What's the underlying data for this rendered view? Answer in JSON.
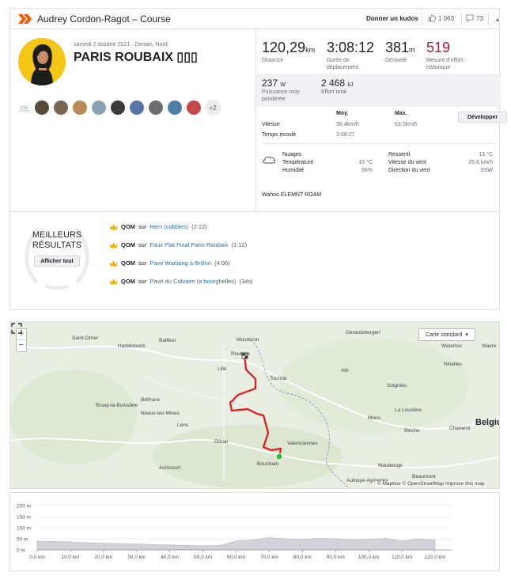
{
  "header": {
    "title": "Audrey Cordon-Ragot – Course",
    "kudos_label": "Donner un kudos",
    "kudos_count": "1 063",
    "comments_count": "73"
  },
  "activity": {
    "date_location": "samedi 2 octobre 2021 · Denain, Nord",
    "name": "PARIS ROUBAIX ▯▯▯",
    "extra_athletes": "+2"
  },
  "stats": {
    "distance": {
      "value": "120,29",
      "unit": "km",
      "label": "Distance"
    },
    "moving_time": {
      "value": "3:08:12",
      "label": "Durée de déplacement"
    },
    "elevation": {
      "value": "381",
      "unit": "m",
      "label": "Dénivelé"
    },
    "suffer": {
      "value": "519",
      "label": "Mesure d'effort : historique"
    },
    "power": {
      "value": "237",
      "unit": "W",
      "label": "Puissance moy. pondérée"
    },
    "work": {
      "value": "2 468",
      "unit": "kJ",
      "label": "Effort total"
    }
  },
  "metrics": {
    "col_avg": "Moy.",
    "col_max": "Max.",
    "develop_label": "Développer",
    "rows": [
      {
        "label": "Vitesse",
        "avg": "38,4km/h",
        "max": "63,0km/h"
      },
      {
        "label": "Temps écoulé",
        "avg": "3:08:27",
        "max": ""
      }
    ]
  },
  "weather": {
    "condition": "Nuages",
    "temp_label": "Température",
    "temp_value": "15 °C",
    "humidity_label": "Humidité",
    "humidity_value": "88%",
    "feels_label": "Ressenti",
    "feels_value": "15 °C",
    "wind_speed_label": "Vitesse du vent",
    "wind_speed_value": "25,6 km/h",
    "wind_dir_label": "Direction du vent",
    "wind_dir_value": "SSW"
  },
  "device": "Wahoo ELEMNT ROAM",
  "best_results": {
    "title_line1": "MEILLEURS",
    "title_line2": "RÉSULTATS",
    "show_all": "Afficher tout",
    "items": [
      {
        "badge": "QOM",
        "on": "sur",
        "segment": "Hem (cobbles)",
        "time": "(2:12)"
      },
      {
        "badge": "QOM",
        "on": "sur",
        "segment": "Faux Plat Final Paris-Roubaix",
        "time": "(1:12)"
      },
      {
        "badge": "QOM",
        "on": "sur",
        "segment": "Pavé Warlaing à Brillon",
        "time": "(4:06)"
      },
      {
        "badge": "QOM",
        "on": "sur",
        "segment": "Pavé du Calvaire (a bourghelles)",
        "time": "(34s)"
      }
    ]
  },
  "map": {
    "zoom_in": "+",
    "zoom_out": "−",
    "style_label": "Carte standard",
    "attribution": "© Mapbox © OpenStreetMap  Improve this map",
    "country": "Belgiu",
    "cities": [
      {
        "name": "Gerardsbergen"
      },
      {
        "name": "Saint-Omer"
      },
      {
        "name": "Bailleul"
      },
      {
        "name": "Mouscron"
      },
      {
        "name": "Hazebrouck"
      },
      {
        "name": "Roubaix"
      },
      {
        "name": "Waterloo"
      },
      {
        "name": "Wavre"
      },
      {
        "name": "Nivelles"
      },
      {
        "name": "Lille"
      },
      {
        "name": "Ath"
      },
      {
        "name": "Tournai"
      },
      {
        "name": "Soignies"
      },
      {
        "name": "Béthune"
      },
      {
        "name": "Bruay-la-Buissière"
      },
      {
        "name": "Noeux-les-Mines"
      },
      {
        "name": "Mons"
      },
      {
        "name": "La Louvière"
      },
      {
        "name": "Lens"
      },
      {
        "name": "Binche"
      },
      {
        "name": "Charleroi"
      },
      {
        "name": "Douai"
      },
      {
        "name": "Valenciennes"
      },
      {
        "name": "Bouchain"
      },
      {
        "name": "Achicourt"
      },
      {
        "name": "Maubeuge"
      },
      {
        "name": "Aulnoye-Aymeries"
      },
      {
        "name": "Beaumont"
      }
    ]
  },
  "elevation": {
    "y_ticks": [
      "200 m",
      "150 m",
      "100 m",
      "50 m",
      "0 m"
    ],
    "x_ticks": [
      "0,0 km",
      "10,0 km",
      "20,0 km",
      "30,0 km",
      "40,0 km",
      "50,0 km",
      "60,0 km",
      "70,0 km",
      "80,0 km",
      "90,0 km",
      "100,0 km",
      "110,0 km",
      "120,0 km"
    ]
  },
  "chart_data": {
    "type": "area",
    "xlabel": "",
    "ylabel": "",
    "ylim": [
      0,
      200
    ],
    "xlim": [
      0,
      125
    ],
    "x": [
      0,
      5,
      10,
      15,
      20,
      25,
      30,
      35,
      40,
      45,
      50,
      55,
      60,
      65,
      70,
      75,
      80,
      85,
      90,
      95,
      100,
      105,
      110,
      115,
      120
    ],
    "values": [
      40,
      38,
      36,
      32,
      30,
      28,
      26,
      24,
      22,
      20,
      18,
      20,
      40,
      45,
      55,
      50,
      48,
      52,
      50,
      46,
      48,
      52,
      40,
      50,
      45
    ]
  },
  "colors": {
    "brand": "#fc5200",
    "route": "#e5161b",
    "link": "#2a6db0",
    "crown": "#f5b400",
    "suffer": "#a5193d",
    "elevation_fill": "#d2d2d8"
  }
}
